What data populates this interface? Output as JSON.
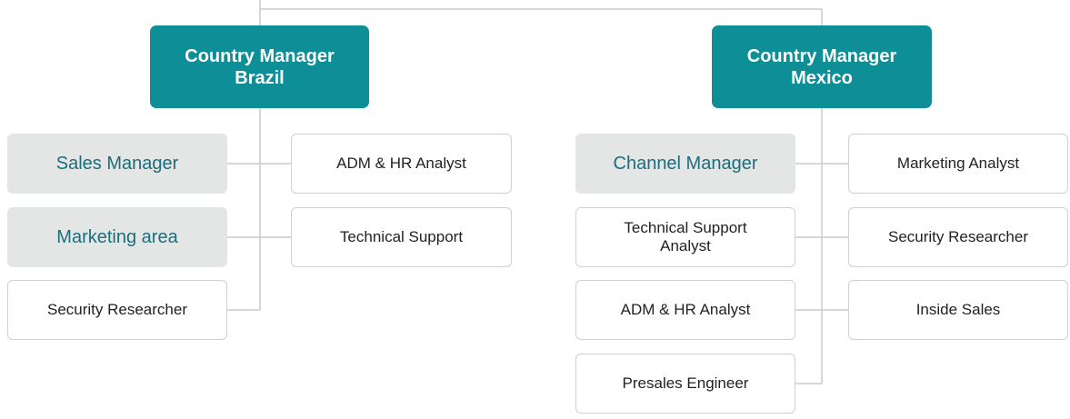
{
  "brazil": {
    "manager": {
      "line1": "Country Manager",
      "line2": "Brazil"
    },
    "left": [
      "Sales Manager",
      "Marketing area",
      "Security Researcher"
    ],
    "right": [
      "ADM & HR Analyst",
      "Technical Support"
    ]
  },
  "mexico": {
    "manager": {
      "line1": "Country Manager",
      "line2": "Mexico"
    },
    "left": [
      "Channel Manager",
      "Technical Support Analyst",
      "ADM & HR Analyst",
      "Presales Engineer"
    ],
    "right": [
      "Marketing Analyst",
      "Security Researcher",
      "Inside Sales"
    ]
  },
  "colors": {
    "manager_fill": "#0e8f97",
    "area_fill": "#e3e6e5",
    "area_text": "#1c6d7a",
    "role_border": "#cdd1d0",
    "connector": "#c8cccb"
  }
}
